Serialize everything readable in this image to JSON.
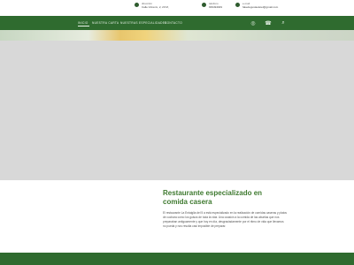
{
  "topbar": {
    "address": {
      "title": "dirección",
      "value": "Calle Ghrenix, 2, 20 M,",
      "icon": "location-pin-icon"
    },
    "phone": {
      "title": "teléfono",
      "value": "939494949",
      "icon": "phone-icon"
    },
    "email": {
      "title": "e-mail",
      "value": "fakedegustaoletel@gmail.com",
      "icon": "mail-icon"
    }
  },
  "nav": {
    "items": [
      "INICIO",
      "NUESTRA CARTA",
      "NUESTRAS ESPECIALIDADES",
      "CONTACTO"
    ],
    "icons": [
      "whatsapp-icon",
      "phone-icon",
      "search-icon"
    ]
  },
  "intro": {
    "title": "Restaurante especializado en comida casera",
    "body": "El restaurante La Entaiglia del 5 a está especializado en la realización de comidas caseras y platos de cuchara como los guisos de toda la vida. Una ocasión a la comida de las abuelas que nos preparaban antiguamente y que hoy en día, desgraciadamente por el ritmo de vida que llevamos no pueda y nos resulta casi imposible de preparar."
  }
}
